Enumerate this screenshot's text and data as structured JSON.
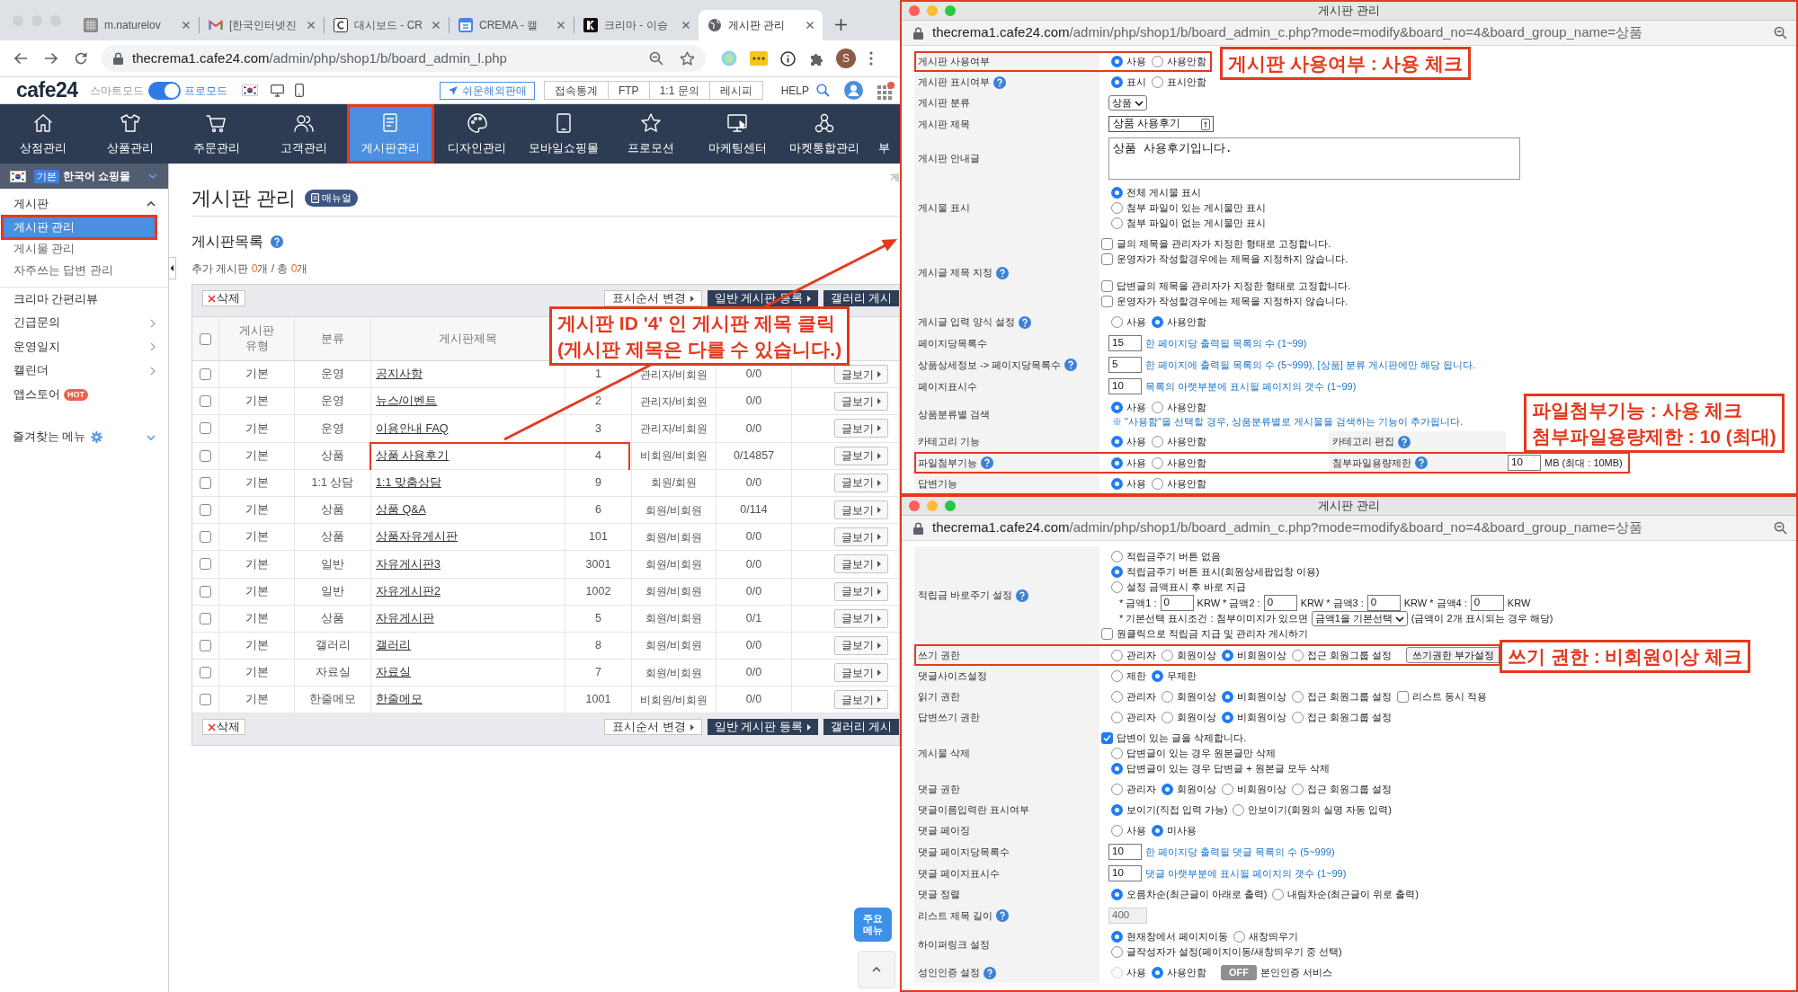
{
  "browser": {
    "tabs": [
      {
        "title": "m.naturelov",
        "selected": false
      },
      {
        "title": "[한국인터넷진",
        "selected": false
      },
      {
        "title": "대시보드 - CR",
        "selected": false
      },
      {
        "title": "CREMA - 캘",
        "selected": false
      },
      {
        "title": "크리마 - 이승",
        "selected": false
      },
      {
        "title": "게시판 관리",
        "selected": true
      }
    ],
    "url": {
      "host": "thecrema1.cafe24.com",
      "path": "/admin/php/shop1/b/board_admin_l.php"
    },
    "profile": "S"
  },
  "header": {
    "logo": "cafe24",
    "mode_off_label": "스마트모드",
    "mode_on_label": "프로모드",
    "pro_mode": true,
    "overseas_button": "쉬운해외판매",
    "tools": [
      "접속통계",
      "FTP",
      "1:1 문의",
      "레시피"
    ],
    "help": "HELP"
  },
  "nav": [
    {
      "label": "상점관리",
      "selected": false,
      "highlighted": false
    },
    {
      "label": "상품관리",
      "selected": false,
      "highlighted": false
    },
    {
      "label": "주문관리",
      "selected": false,
      "highlighted": false
    },
    {
      "label": "고객관리",
      "selected": false,
      "highlighted": false
    },
    {
      "label": "게시판관리",
      "selected": true,
      "highlighted": true
    },
    {
      "label": "디자인관리",
      "selected": false,
      "highlighted": false
    },
    {
      "label": "모바일쇼핑몰",
      "selected": false,
      "highlighted": false
    },
    {
      "label": "프로모션",
      "selected": false,
      "highlighted": false
    },
    {
      "label": "마케팅센터",
      "selected": false,
      "highlighted": false
    },
    {
      "label": "마켓통합관리",
      "selected": false,
      "highlighted": false
    },
    {
      "label": "부",
      "selected": false,
      "highlighted": false
    }
  ],
  "sidebar": {
    "shop": {
      "badge": "기본",
      "name": "한국어 쇼핑몰"
    },
    "groups": [
      {
        "label": "게시판",
        "expanded": true,
        "items": [
          {
            "label": "게시판 관리",
            "selected": true,
            "highlighted": true
          },
          {
            "label": "게시물 관리",
            "selected": false,
            "highlighted": false
          },
          {
            "label": "자주쓰는 답변 관리",
            "selected": false,
            "highlighted": false
          }
        ]
      }
    ],
    "links": [
      {
        "label": "크리마 간편리뷰",
        "submenu": false
      },
      {
        "label": "긴급문의",
        "submenu": true
      },
      {
        "label": "운영일지",
        "submenu": true
      },
      {
        "label": "캘린더",
        "submenu": true
      },
      {
        "label": "앱스토어",
        "submenu": false,
        "badge": "HOT"
      }
    ],
    "favorites": "즐겨찾는 메뉴"
  },
  "page": {
    "breadcrumb": "게",
    "title": "게시판 관리",
    "manual": "매뉴얼",
    "section_title": "게시판목록",
    "summary": [
      {
        "text": "추가 게시판 ",
        "highlight": false
      },
      {
        "text": "0",
        "highlight": true
      },
      {
        "text": "개 / 총 ",
        "highlight": false
      },
      {
        "text": "0",
        "highlight": true
      },
      {
        "text": "개",
        "highlight": false
      }
    ],
    "toolbar": {
      "delete": "삭제",
      "buttons": [
        {
          "label": "표시순서 변경",
          "kind": "light",
          "caret": true
        },
        {
          "label": "일반 게시판 등록",
          "kind": "dark",
          "caret": true
        },
        {
          "label": "갤러리 게시",
          "kind": "dark",
          "caret": false
        }
      ]
    },
    "table": {
      "select_all": false,
      "columns": [
        "게시판 유형",
        "분류",
        "게시판제목"
      ],
      "rows": [
        {
          "checked": false,
          "type": "기본",
          "category": "운영",
          "title": "공지사항",
          "column_5": "1",
          "column_6": "관리자/비회원",
          "column_7": "0/0",
          "action": "글보기",
          "highlighted": false
        },
        {
          "checked": false,
          "type": "기본",
          "category": "운영",
          "title": "뉴스/이벤트",
          "column_5": "2",
          "column_6": "관리자/비회원",
          "column_7": "0/0",
          "action": "글보기",
          "highlighted": false
        },
        {
          "checked": false,
          "type": "기본",
          "category": "운영",
          "title": "이용안내 FAQ",
          "column_5": "3",
          "column_6": "관리자/비회원",
          "column_7": "0/0",
          "action": "글보기",
          "highlighted": false
        },
        {
          "checked": false,
          "type": "기본",
          "category": "상품",
          "title": "상품 사용후기",
          "column_5": "4",
          "column_6": "비회원/비회원",
          "column_7": "0/14857",
          "action": "글보기",
          "highlighted": true
        },
        {
          "checked": false,
          "type": "기본",
          "category": "1:1 상담",
          "title": "1:1 맞춤상담",
          "column_5": "9",
          "column_6": "회원/회원",
          "column_7": "0/0",
          "action": "글보기",
          "highlighted": false
        },
        {
          "checked": false,
          "type": "기본",
          "category": "상품",
          "title": "상품 Q&A",
          "column_5": "6",
          "column_6": "회원/비회원",
          "column_7": "0/114",
          "action": "글보기",
          "highlighted": false
        },
        {
          "checked": false,
          "type": "기본",
          "category": "상품",
          "title": "상품자유게시판",
          "column_5": "101",
          "column_6": "회원/비회원",
          "column_7": "0/0",
          "action": "글보기",
          "highlighted": false
        },
        {
          "checked": false,
          "type": "기본",
          "category": "일반",
          "title": "자유게시판3",
          "column_5": "3001",
          "column_6": "회원/비회원",
          "column_7": "0/0",
          "action": "글보기",
          "highlighted": false
        },
        {
          "checked": false,
          "type": "기본",
          "category": "일반",
          "title": "자유게시판2",
          "column_5": "1002",
          "column_6": "회원/비회원",
          "column_7": "0/0",
          "action": "글보기",
          "highlighted": false
        },
        {
          "checked": false,
          "type": "기본",
          "category": "상품",
          "title": "자유게시판",
          "column_5": "5",
          "column_6": "회원/비회원",
          "column_7": "0/1",
          "action": "글보기",
          "highlighted": false
        },
        {
          "checked": false,
          "type": "기본",
          "category": "갤러리",
          "title": "갤러리",
          "column_5": "8",
          "column_6": "회원/비회원",
          "column_7": "0/0",
          "action": "글보기",
          "highlighted": false
        },
        {
          "checked": false,
          "type": "기본",
          "category": "자료실",
          "title": "자료실",
          "column_5": "7",
          "column_6": "회원/비회원",
          "column_7": "0/0",
          "action": "글보기",
          "highlighted": false
        },
        {
          "checked": false,
          "type": "기본",
          "category": "한줄메모",
          "title": "한줄메모",
          "column_5": "1001",
          "column_6": "비회원/비회원",
          "column_7": "0/0",
          "action": "글보기",
          "highlighted": false
        }
      ]
    },
    "bottom_toolbar": {
      "delete": "삭제",
      "buttons": [
        {
          "label": "표시순서 변경",
          "kind": "light",
          "caret": true
        },
        {
          "label": "일반 게시판 등록",
          "kind": "dark",
          "caret": true
        },
        {
          "label": "갤러리 게시",
          "kind": "dark",
          "caret": false
        }
      ]
    },
    "floating_menu": "주요 메뉴"
  },
  "popups": [
    {
      "title": "게시판 관리",
      "highlighted": true,
      "url": {
        "host": "thecrema1.cafe24.com",
        "path": "/admin/php/shop1/b/board_admin_c.php?mode=modify&board_no=4&board_group_name=상품"
      },
      "rows": [
        {
          "label": "게시판 사용여부",
          "help": false,
          "highlighted": true,
          "lines": [
            [
              {
                "kind": "radio",
                "label": "사용",
                "checked": true
              },
              {
                "kind": "radio",
                "label": "사용안함",
                "checked": false
              }
            ]
          ]
        },
        {
          "label": "게시판 표시여부",
          "help": true,
          "highlighted": false,
          "lines": [
            [
              {
                "kind": "radio",
                "label": "표시",
                "checked": true
              },
              {
                "kind": "radio",
                "label": "표시안함",
                "checked": false
              }
            ]
          ]
        },
        {
          "label": "게시판 분류",
          "help": false,
          "highlighted": false,
          "lines": [
            [
              {
                "kind": "select",
                "value": "상품"
              }
            ]
          ]
        },
        {
          "label": "게시판 제목",
          "help": false,
          "highlighted": false,
          "lines": [
            [
              {
                "kind": "title_input",
                "value": "상품 사용후기"
              }
            ]
          ]
        },
        {
          "label": "게시판 안내글",
          "help": false,
          "highlighted": false,
          "lines": [
            [
              {
                "kind": "textarea",
                "value": "상품 사용후기입니다."
              }
            ]
          ]
        },
        {
          "label": "게시물 표시",
          "help": false,
          "highlighted": false,
          "lines": [
            [
              {
                "kind": "radio",
                "label": "전체 게시물 표시",
                "checked": true
              }
            ],
            [
              {
                "kind": "radio",
                "label": "첨부 파일이 있는 게시물만 표시",
                "checked": false
              }
            ],
            [
              {
                "kind": "radio",
                "label": "첨부 파일이 없는 게시물만 표시",
                "checked": false
              }
            ]
          ]
        },
        {
          "label": "게시글 제목 지정",
          "help": true,
          "highlighted": false,
          "blocks": [
            [
              [
                {
                  "kind": "checkbox",
                  "label": "글의 제목을 관리자가 지정한 형태로 고정합니다.",
                  "checked": false
                }
              ],
              [
                {
                  "kind": "checkbox",
                  "label": "운영자가 작성할경우에는 제목을 지정하지 않습니다.",
                  "checked": false
                }
              ]
            ],
            [
              [
                {
                  "kind": "checkbox",
                  "label": "답변글의 제목을 관리자가 지정한 형태로 고정합니다.",
                  "checked": false
                }
              ],
              [
                {
                  "kind": "checkbox",
                  "label": "운영자가 작성할경우에는 제목을 지정하지 않습니다.",
                  "checked": false
                }
              ]
            ]
          ]
        },
        {
          "label": "게시글 입력 양식 설정",
          "help": true,
          "highlighted": false,
          "lines": [
            [
              {
                "kind": "radio",
                "label": "사용",
                "checked": false
              },
              {
                "kind": "radio",
                "label": "사용안함",
                "checked": true
              }
            ]
          ]
        },
        {
          "label": "페이지당목록수",
          "help": false,
          "highlighted": false,
          "lines": [
            [
              {
                "kind": "input",
                "value": "15"
              },
              {
                "kind": "hint",
                "text": "한 페이지당 출력될 목록의 수 (1~99)"
              }
            ]
          ]
        },
        {
          "label": "상품상세정보 -> 페이지당목록수",
          "help": true,
          "highlighted": false,
          "lines": [
            [
              {
                "kind": "input",
                "value": "5"
              },
              {
                "kind": "hint",
                "text": "한 페이지에 출력될 목록의 수 (5~999), [상품] 분류 게시판에만 해당 됩니다."
              }
            ]
          ]
        },
        {
          "label": "페이지표시수",
          "help": false,
          "highlighted": false,
          "lines": [
            [
              {
                "kind": "input",
                "value": "10"
              },
              {
                "kind": "hint",
                "text": "목록의 아랫부분에 표시될 페이지의 갯수 (1~99)"
              }
            ]
          ]
        },
        {
          "label": "상품분류별 검색",
          "help": false,
          "highlighted": false,
          "lines": [
            [
              {
                "kind": "radio",
                "label": "사용",
                "checked": true
              },
              {
                "kind": "radio",
                "label": "사용안함",
                "checked": false
              }
            ],
            [
              {
                "kind": "note",
                "text": "※ \"사용함\"을 선택할 경우, 상품분류별로 게시물을 검색하는 기능이 추가됩니다."
              }
            ]
          ]
        },
        {
          "label": "카테고리 기능",
          "help": false,
          "highlighted": false,
          "lines": [
            [
              {
                "kind": "radio",
                "label": "사용",
                "checked": true
              },
              {
                "kind": "radio",
                "label": "사용안함",
                "checked": false
              }
            ]
          ],
          "side": {
            "label": "카테고리 편집",
            "help": true
          }
        },
        {
          "label": "파일첨부기능",
          "help": true,
          "highlighted": true,
          "lines": [
            [
              {
                "kind": "radio",
                "label": "사용",
                "checked": true
              },
              {
                "kind": "radio",
                "label": "사용안함",
                "checked": false
              }
            ]
          ],
          "side": {
            "label": "첨부파일용량제한",
            "help": true,
            "items": [
              {
                "kind": "input",
                "value": "10"
              },
              {
                "kind": "text",
                "text": "MB (최대 : 10MB)"
              }
            ]
          }
        },
        {
          "label": "답변기능",
          "help": false,
          "highlighted": false,
          "lines": [
            [
              {
                "kind": "radio",
                "label": "사용",
                "checked": true
              },
              {
                "kind": "radio",
                "label": "사용안함",
                "checked": false
              }
            ]
          ]
        }
      ]
    },
    {
      "title": "게시판 관리",
      "highlighted": true,
      "url": {
        "host": "thecrema1.cafe24.com",
        "path": "/admin/php/shop1/b/board_admin_c.php?mode=modify&board_no=4&board_group_name=상품"
      },
      "rows": [
        {
          "label": "적립금 바로주기 설정",
          "help": true,
          "highlighted": false,
          "lines": [
            [
              {
                "kind": "radio",
                "label": "적립금주기 버튼 없음",
                "checked": false
              }
            ],
            [
              {
                "kind": "radio",
                "label": "적립금주기 버튼 표시(회원상세팝업창 이용)",
                "checked": true
              }
            ],
            [
              {
                "kind": "radio",
                "label": "설정 금액표시 후 바로 지급",
                "checked": false
              }
            ],
            [
              {
                "kind": "text",
                "text": "* 금액1 :"
              },
              {
                "kind": "input",
                "value": "0"
              },
              {
                "kind": "text",
                "text": "KRW * 금액2 :"
              },
              {
                "kind": "input",
                "value": "0"
              },
              {
                "kind": "text",
                "text": "KRW * 금액3 :"
              },
              {
                "kind": "input",
                "value": "0"
              },
              {
                "kind": "text",
                "text": "KRW * 금액4 :"
              },
              {
                "kind": "input",
                "value": "0"
              },
              {
                "kind": "text",
                "text": "KRW"
              }
            ],
            [
              {
                "kind": "text",
                "text": "* 기본선택 표시조건 : 첨부이미지가 있으면"
              },
              {
                "kind": "select",
                "value": "금액1을 기본선택"
              },
              {
                "kind": "text",
                "text": "(금액이 2개 표시되는 경우 해당)"
              }
            ],
            [
              {
                "kind": "checkbox",
                "label": "원클릭으로 적립금 지급 및 관리자 게시하기",
                "checked": false
              }
            ]
          ]
        },
        {
          "label": "쓰기 권한",
          "help": false,
          "highlighted": true,
          "lines": [
            [
              {
                "kind": "radio",
                "label": "관리자",
                "checked": false
              },
              {
                "kind": "radio",
                "label": "회원이상",
                "checked": false
              },
              {
                "kind": "radio",
                "label": "비회원이상",
                "checked": true
              },
              {
                "kind": "radio",
                "label": "접근 회원그룹 설정",
                "checked": false
              },
              {
                "kind": "button",
                "label": "쓰기권한 부가설정"
              }
            ]
          ]
        },
        {
          "label": "댓글사이즈설정",
          "help": false,
          "highlighted": false,
          "lines": [
            [
              {
                "kind": "radio",
                "label": "제한",
                "checked": false
              },
              {
                "kind": "radio",
                "label": "무제한",
                "checked": true
              }
            ]
          ]
        },
        {
          "label": "읽기 권한",
          "help": false,
          "highlighted": false,
          "lines": [
            [
              {
                "kind": "radio",
                "label": "관리자",
                "checked": false
              },
              {
                "kind": "radio",
                "label": "회원이상",
                "checked": false
              },
              {
                "kind": "radio",
                "label": "비회원이상",
                "checked": true
              },
              {
                "kind": "radio",
                "label": "접근 회원그룹 설정",
                "checked": false
              },
              {
                "kind": "checkbox",
                "label": "리스트 동시 적용",
                "checked": false
              }
            ]
          ]
        },
        {
          "label": "답변쓰기 권한",
          "help": false,
          "highlighted": false,
          "lines": [
            [
              {
                "kind": "radio",
                "label": "관리자",
                "checked": false
              },
              {
                "kind": "radio",
                "label": "회원이상",
                "checked": false
              },
              {
                "kind": "radio",
                "label": "비회원이상",
                "checked": true
              },
              {
                "kind": "radio",
                "label": "접근 회원그룹 설정",
                "checked": false
              }
            ]
          ]
        },
        {
          "label": "게시물 삭제",
          "help": false,
          "highlighted": false,
          "lines": [
            [
              {
                "kind": "checkbox",
                "label": "답변이 있는 글을 삭제합니다.",
                "checked": true
              }
            ],
            [
              {
                "kind": "radio",
                "label": "답변글이 있는 경우 원본글만 삭제",
                "checked": false
              }
            ],
            [
              {
                "kind": "radio",
                "label": "답변글이 있는 경우 답변글 + 원본글 모두 삭제",
                "checked": true
              }
            ]
          ]
        },
        {
          "label": "댓글 권한",
          "help": false,
          "highlighted": false,
          "lines": [
            [
              {
                "kind": "radio",
                "label": "관리자",
                "checked": false
              },
              {
                "kind": "radio",
                "label": "회원이상",
                "checked": true
              },
              {
                "kind": "radio",
                "label": "비회원이상",
                "checked": false
              },
              {
                "kind": "radio",
                "label": "접근 회원그룹 설정",
                "checked": false
              }
            ]
          ]
        },
        {
          "label": "댓글이름입력란 표시여부",
          "help": false,
          "highlighted": false,
          "lines": [
            [
              {
                "kind": "radio",
                "label": "보이기(직접 입력 가능)",
                "checked": true
              },
              {
                "kind": "radio",
                "label": "안보이기(회원의 실명 자동 입력)",
                "checked": false
              }
            ]
          ]
        },
        {
          "label": "댓글 페이징",
          "help": false,
          "highlighted": false,
          "lines": [
            [
              {
                "kind": "radio",
                "label": "사용",
                "checked": false
              },
              {
                "kind": "radio",
                "label": "미사용",
                "checked": true
              }
            ]
          ]
        },
        {
          "label": "댓글 페이지당목록수",
          "help": false,
          "highlighted": false,
          "lines": [
            [
              {
                "kind": "input",
                "value": "10"
              },
              {
                "kind": "hint",
                "text": "한 페이지당 출력될 댓글 목록의 수 (5~999)"
              }
            ]
          ]
        },
        {
          "label": "댓글 페이지표시수",
          "help": false,
          "highlighted": false,
          "lines": [
            [
              {
                "kind": "input",
                "value": "10"
              },
              {
                "kind": "hint",
                "text": "댓글 아랫부분에 표시될 페이지의 갯수 (1~99)"
              }
            ]
          ]
        },
        {
          "label": "댓글 정렬",
          "help": false,
          "highlighted": false,
          "lines": [
            [
              {
                "kind": "radio",
                "label": "오름차순(최근글이 아래로 출력)",
                "checked": true
              },
              {
                "kind": "radio",
                "label": "내림차순(최근글이 위로 출력)",
                "checked": false
              }
            ]
          ]
        },
        {
          "label": "리스트 제목 길이",
          "help": true,
          "highlighted": false,
          "lines": [
            [
              {
                "kind": "input",
                "value": "400",
                "disabled": true
              }
            ]
          ]
        },
        {
          "label": "하이퍼링크 설정",
          "help": false,
          "highlighted": false,
          "lines": [
            [
              {
                "kind": "radio",
                "label": "현재창에서 페이지이동",
                "checked": true
              },
              {
                "kind": "radio",
                "label": "새창띄우기",
                "checked": false
              }
            ],
            [
              {
                "kind": "radio",
                "label": "글작성자가 설정(페이지이동/새창띄우기 중 선택)",
                "checked": false
              }
            ]
          ]
        },
        {
          "label": "성인인증 설정",
          "help": true,
          "highlighted": false,
          "lines": [
            [
              {
                "kind": "radio",
                "label": "사용",
                "checked": false,
                "disabled": true
              },
              {
                "kind": "radio",
                "label": "사용안함",
                "checked": true,
                "disabled": false
              },
              {
                "kind": "toggle",
                "label": "OFF",
                "on": false
              },
              {
                "kind": "text",
                "text": "본인인증 서비스"
              }
            ]
          ]
        }
      ]
    }
  ],
  "annotations": [
    {
      "lines": [
        "게시판 ID '4' 인 게시판 제목 클릭",
        "(게시판 제목은 다를 수 있습니다.)"
      ]
    },
    {
      "lines": [
        "게시판 사용여부 : 사용 체크"
      ]
    },
    {
      "lines": [
        "파일첨부기능 : 사용 체크",
        "첨부파일용량제한 : 10 (최대)"
      ]
    },
    {
      "lines": [
        "쓰기 권한 : 비회원이상 체크"
      ]
    }
  ]
}
